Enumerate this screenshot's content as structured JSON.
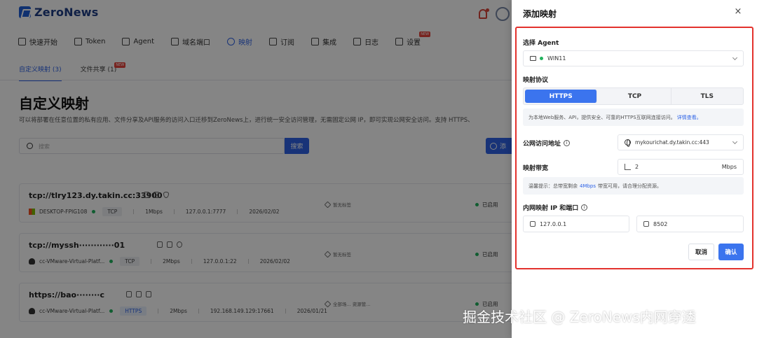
{
  "app": {
    "logo_text": "ZeroNews",
    "nav": [
      {
        "label": "快速开始"
      },
      {
        "label": "Token"
      },
      {
        "label": "Agent"
      },
      {
        "label": "域名端口"
      },
      {
        "label": "映射"
      },
      {
        "label": "订阅"
      },
      {
        "label": "集成"
      },
      {
        "label": "日志"
      },
      {
        "label": "设置"
      }
    ],
    "new_badge": "NEW",
    "subtabs": [
      {
        "label": "自定义映射 (3)"
      },
      {
        "label": "文件共享 (1)"
      }
    ],
    "page_title": "自定义映射",
    "page_desc": "可以将部署在任意位置的私有应用、文件分享及API服务的访问入口迁移到ZeroNews上，进行统一安全访问管理，无需固定公网 IP，即可实现公网安全访问。支持 HTTPS、",
    "search_placeholder": "搜索",
    "search_btn": "搜索",
    "add_btn": "添",
    "mappings": [
      {
        "address": "tcp://tlry123.dy.takin.cc:33900",
        "agent": "DESKTOP-FPIG108",
        "protocol": "TCP",
        "bandwidth": "1Mbps",
        "target": "127.0.0.1:7777",
        "date": "2026/02/02",
        "tags": "暂无标签",
        "status": "已启用"
      },
      {
        "address": "tcp://myssh············01",
        "agent": "cc-VMware-Virtual-Platf...",
        "protocol": "TCP",
        "bandwidth": "2Mbps",
        "target": "127.0.0.1:22",
        "date": "2026/02/02",
        "tags": "暂无标签",
        "status": "已启用"
      },
      {
        "address": "https://bao········c",
        "agent": "cc-VMware-Virtual-Platf...",
        "protocol": "HTTPS",
        "bandwidth": "2Mbps",
        "target": "192.168.149.129:17661",
        "date": "2026/01/21",
        "tags": "全部场...  资源管...",
        "status": "已启用"
      }
    ]
  },
  "drawer": {
    "title": "添加映射",
    "close": "×",
    "agent_label": "选择 Agent",
    "agent_value": "WIN11",
    "protocol_label": "映射协议",
    "protocols": [
      "HTTPS",
      "TCP",
      "TLS"
    ],
    "protocol_hint": "为本地Web服务、API，提供安全、可靠的HTTPS互联网连接访问。",
    "protocol_hint_link": "详情查看。",
    "domain_label": "公网访问地址",
    "domain_value": "mykourichat.dy.takin.cc:443",
    "bandwidth_label": "映射带宽",
    "bandwidth_value": "2",
    "bandwidth_unit": "Mbps",
    "bandwidth_hint_pre": "温馨提示：总带宽剩余",
    "bandwidth_hint_value": "4Mbps",
    "bandwidth_hint_post": "带宽可用，请合理分配资源。",
    "ip_port_label": "内网映射 IP 和端口",
    "ip_value": "127.0.0.1",
    "port_value": "8502",
    "cancel": "取消",
    "confirm": "确认",
    "info_glyph": "i"
  },
  "watermark": "掘金技术社区 @ ZeroNews内网穿透",
  "colors": {
    "accent": "#3b74ee",
    "highlight_border": "#e3322d",
    "online": "#22b35e"
  }
}
